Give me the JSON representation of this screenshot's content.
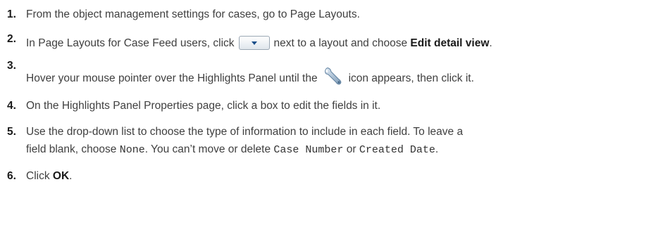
{
  "steps": [
    {
      "num": "1.",
      "text": "From the object management settings for cases, go to Page Layouts."
    },
    {
      "num": "2.",
      "pre": "In Page Layouts for Case Feed users, click",
      "mid": "next to a layout and choose",
      "bold": "Edit detail view",
      "post": ".",
      "icon": "dropdown-button-icon"
    },
    {
      "num": "3.",
      "pre": "Hover your mouse pointer over the Highlights Panel until the",
      "post": "icon appears, then click it.",
      "icon": "wrench-icon"
    },
    {
      "num": "4.",
      "text": "On the Highlights Panel Properties page, click a box to edit the fields in it."
    },
    {
      "num": "5.",
      "line1": "Use the drop-down list to choose the type of information to include in each field. To leave a",
      "l2a": "field blank, choose",
      "code1": "None",
      "l2b": ". You can’t move or delete",
      "code2": "Case Number",
      "l2c": "or",
      "code3": "Created Date",
      "l2d": "."
    },
    {
      "num": "6.",
      "pre": "Click",
      "bold": "OK",
      "post": "."
    }
  ],
  "colors": {
    "text": "#3f3f3f",
    "number": "#1a1a1a",
    "icon_accent": "#1b4f8a"
  }
}
